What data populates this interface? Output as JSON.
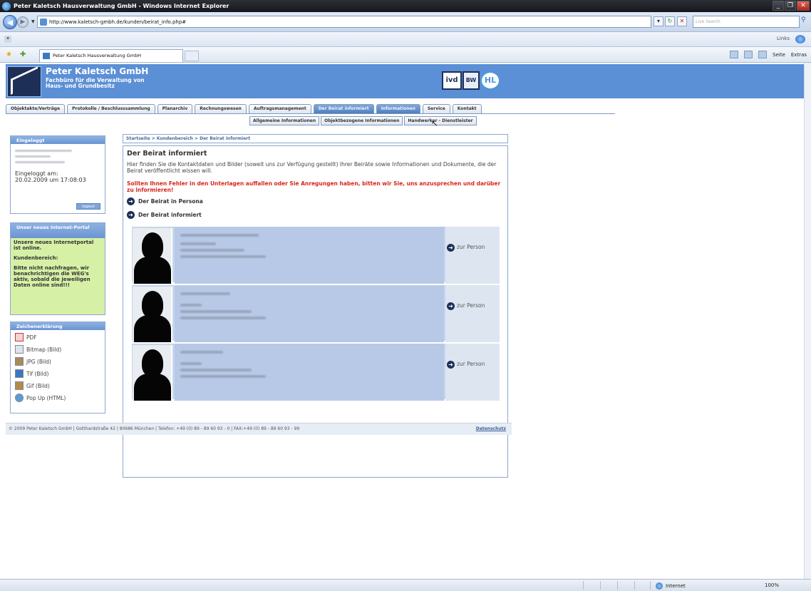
{
  "browser": {
    "window_title": "Peter Kaletsch Hausverwaltung GmbH - Windows Internet Explorer",
    "url": "http://www.kaletsch-gmbh.de/kunden/beirat_info.php#",
    "search_placeholder": "Live Search",
    "tab_title": "Peter Kaletsch Hausverwaltung GmbH",
    "links_label": "Links",
    "page_menu": "Seite",
    "extras_menu": "Extras",
    "status_zone": "Internet",
    "zoom": "100%"
  },
  "site": {
    "name": "Peter Kaletsch GmbH",
    "subtitle_line1": "Fachbüro für die Verwaltung von",
    "subtitle_line2": "Haus- und Grundbesitz",
    "badges": [
      "ivd",
      "BW",
      "HL"
    ]
  },
  "mainnav": [
    "Objektakte/Verträge",
    "Protokolle / Beschlusssammlung",
    "Planarchiv",
    "Rechnungswesen",
    "Auftragsmanagement",
    "Der Beirat informiert",
    "Informationen",
    "Service",
    "Kontakt"
  ],
  "subnav": [
    "Allgemeine Informationen",
    "Objektbezogene Informationen",
    "Handwerker - Dienstleister"
  ],
  "sidebar": {
    "login": {
      "title": "Eingeloggt",
      "time_label": "Eingeloggt am:",
      "time_value": "20.02.2009 um 17:08:03",
      "logout_label": "logout"
    },
    "portal": {
      "title": "Unser neues Internet-Portal",
      "text1": "Unsere neues Internetportal ist online.",
      "text2": "Kundenbereich:",
      "text3": "Bitte nicht nachfragen, wir benachrichtigen die WEG's aktiv, sobald die jeweiligen Daten online sind!!!"
    },
    "legend": {
      "title": "Zeichenerklärung",
      "items": [
        "PDF",
        "Bitmap (Bild)",
        "JPG (Bild)",
        "Tif (Bild)",
        "Gif (Bild)",
        "Pop Up (HTML)"
      ]
    }
  },
  "content": {
    "breadcrumb": "Startseite > Kundenbereich > Der Beirat informiert",
    "heading": "Der Beirat informiert",
    "intro": "Hier finden Sie die Kontaktdaten und Bilder (soweit uns zur Verfügung gestellt) Ihrer Beiräte sowie Informationen und Dokumente, die der Beirat veröffentlicht wissen will.",
    "warning": "Sollten Ihnen Fehler in den Unterlagen auffallen oder Sie Anregungen haben, bitten wir Sie, uns anzusprechen und darüber zu informieren!",
    "link1": "Der Beirat in Persona",
    "link2": "Der Beirat informiert",
    "person_action": "zur Person"
  },
  "footer": {
    "text": "© 2009 Peter Kaletsch GmbH | Gotthardstraße 42 | 80686 München | Telefon: +49 (0) 89 - 89 60 93 - 0 | FAX:+49 (0) 89 - 89 60 93 - 99",
    "privacy": "Datenschutz"
  },
  "colors": {
    "header_blue": "#5b8fd6",
    "warning_red": "#d8261c",
    "portal_green": "#d6f0a6"
  }
}
